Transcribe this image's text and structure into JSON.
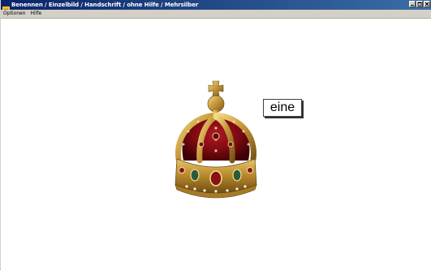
{
  "window": {
    "title": "Benennen / Einzelbild / Handschrift / ohne Hilfe / Mehrsilber",
    "icon": "app-icon"
  },
  "menu": {
    "items": [
      {
        "label": "Optionen"
      },
      {
        "label": "Hilfe"
      }
    ]
  },
  "content": {
    "image_subject": "crown",
    "word": "eine"
  },
  "colors": {
    "titlebar_start": "#0a246a",
    "titlebar_end": "#3a6ea5",
    "crown_gold": "#c9a047",
    "crown_red": "#8b0a14"
  }
}
